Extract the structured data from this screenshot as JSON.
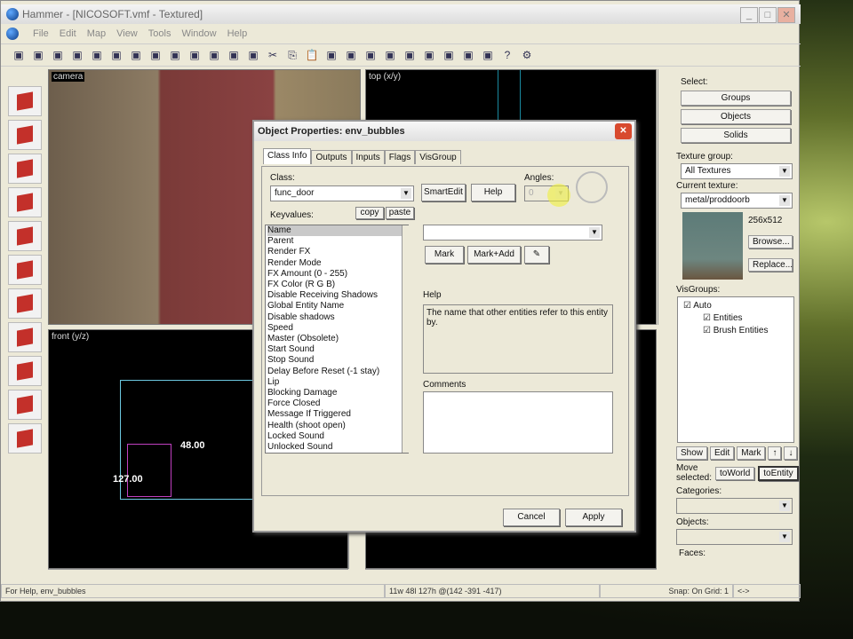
{
  "window": {
    "title": "Hammer - [NICOSOFT.vmf - Textured]",
    "minimize": "_",
    "maximize": "□",
    "close": "✕"
  },
  "menu": [
    "File",
    "Edit",
    "Map",
    "View",
    "Tools",
    "Window",
    "Help"
  ],
  "toolbar_icons": [
    "grid-icon",
    "3d-grid-icon",
    "dot-grid-icon",
    "dot-grid2-icon",
    "texture-lock-icon",
    "texture-lock2-icon",
    "carve-icon",
    "group-icon",
    "ungroup-icon",
    "ignore-groups-icon",
    "hide-icon",
    "show-icon",
    "hide2-icon",
    "cut-icon",
    "copy-icon",
    "paste-icon",
    "toolbar-icon",
    "texture-app-icon",
    "bounding-box-icon",
    "select-icon",
    "toggle-icon",
    "flip-icon",
    "camera-icon",
    "run-map-icon",
    "load-icon",
    "help-icon",
    "gear-icon"
  ],
  "viewports": {
    "camera": "camera",
    "top": "top (x/y)",
    "front": "front (y/z)",
    "front_dims": {
      "width": "48.00",
      "height": "127.00"
    }
  },
  "dialog": {
    "title": "Object Properties: env_bubbles",
    "close": "✕",
    "tabs": [
      "Class Info",
      "Outputs",
      "Inputs",
      "Flags",
      "VisGroup"
    ],
    "class_label": "Class:",
    "class_value": "func_door",
    "smartedit": "SmartEdit",
    "help_btn": "Help",
    "angles_label": "Angles:",
    "angles_value": "0",
    "keyvalues_label": "Keyvalues:",
    "copy": "copy",
    "paste": "paste",
    "keyvalues": [
      "Name",
      "Parent",
      "Render FX",
      "Render Mode",
      "FX Amount (0 - 255)",
      "FX Color (R G B)",
      "Disable Receiving Shadows",
      "Global Entity Name",
      "Disable shadows",
      "Speed",
      "Master (Obsolete)",
      "Start Sound",
      "Stop Sound",
      "Delay Before Reset (-1 stay)",
      "Lip",
      "Blocking Damage",
      "Force Closed",
      "Message If Triggered",
      "Health (shoot open)",
      "Locked Sound",
      "Unlocked Sound"
    ],
    "selected_key": "Name",
    "mark": "Mark",
    "mark_add": "Mark+Add",
    "help_label": "Help",
    "help_text": "The name that other entities refer to this entity by.",
    "comments_label": "Comments",
    "cancel": "Cancel",
    "apply": "Apply"
  },
  "right_panel": {
    "select_label": "Select:",
    "groups": "Groups",
    "objects": "Objects",
    "solids": "Solids",
    "texture_group_label": "Texture group:",
    "texture_group": "All Textures",
    "current_texture_label": "Current texture:",
    "current_texture": "metal/proddoorb",
    "texture_size": "256x512",
    "browse": "Browse...",
    "replace": "Replace...",
    "visgroups_label": "VisGroups:",
    "visgroups": [
      "Auto",
      "Entities",
      "Brush Entities"
    ],
    "show": "Show",
    "edit": "Edit",
    "mark": "Mark",
    "up": "↑",
    "down": "↓",
    "move_selected": "Move selected:",
    "to_world": "toWorld",
    "to_entity": "toEntity",
    "categories_label": "Categories:",
    "objects_label": "Objects:",
    "faces_label": "Faces:"
  },
  "status": {
    "help": "For Help, env_bubbles",
    "size": "11w 48l 127h @(142 -391 -417)",
    "snap": "Snap: On Grid: 1",
    "extra": "<->"
  }
}
